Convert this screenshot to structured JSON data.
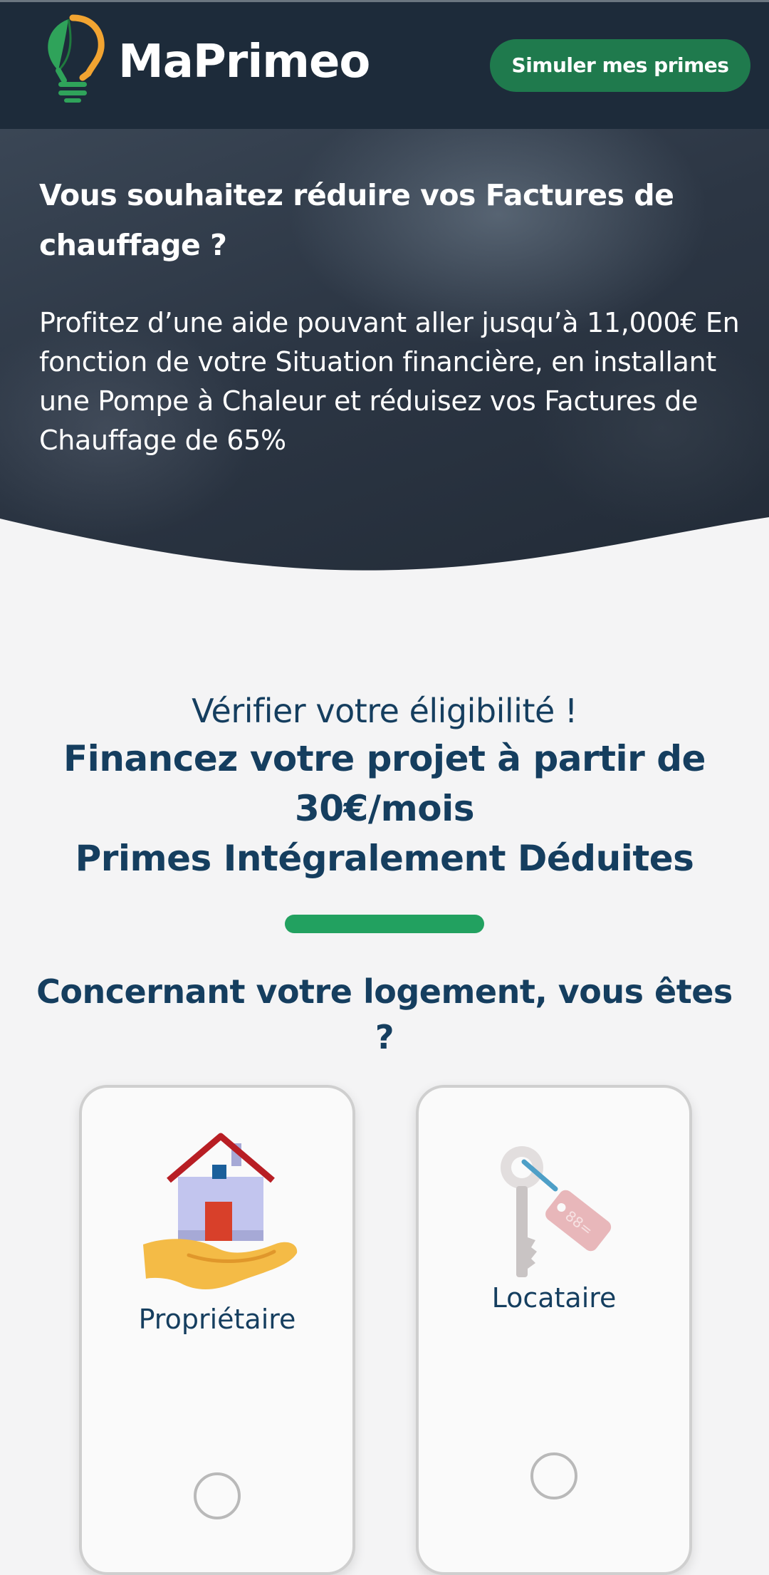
{
  "header": {
    "brand_name": "MaPrimeo",
    "cta_label": "Simuler mes primes"
  },
  "hero": {
    "title": "Vous souhaitez réduire vos Factures de chauffage ?",
    "text": "Profitez d’une aide pouvant aller jusqu’à 11,000€ En fonction de votre Situation financière, en installant une Pompe à Chaleur et réduisez vos Factures de Chauffage de 65%"
  },
  "eligibility": {
    "subtitle": "Vérifier votre éligibilité !",
    "title_line1": "Financez votre projet à partir de 30€/mois",
    "title_line2": "Primes Intégralement Déduites"
  },
  "question": {
    "text": "Concernant votre logement, vous êtes ?",
    "options": [
      {
        "label": "Propriétaire",
        "icon": "house-in-hand-icon",
        "selected": false
      },
      {
        "label": "Locataire",
        "icon": "key-tag-icon",
        "selected": false
      }
    ]
  },
  "colors": {
    "header_bg": "#1d2b3a",
    "cta_bg": "#1f7a4d",
    "accent_green": "#22a160",
    "text_navy": "#153e5f"
  }
}
